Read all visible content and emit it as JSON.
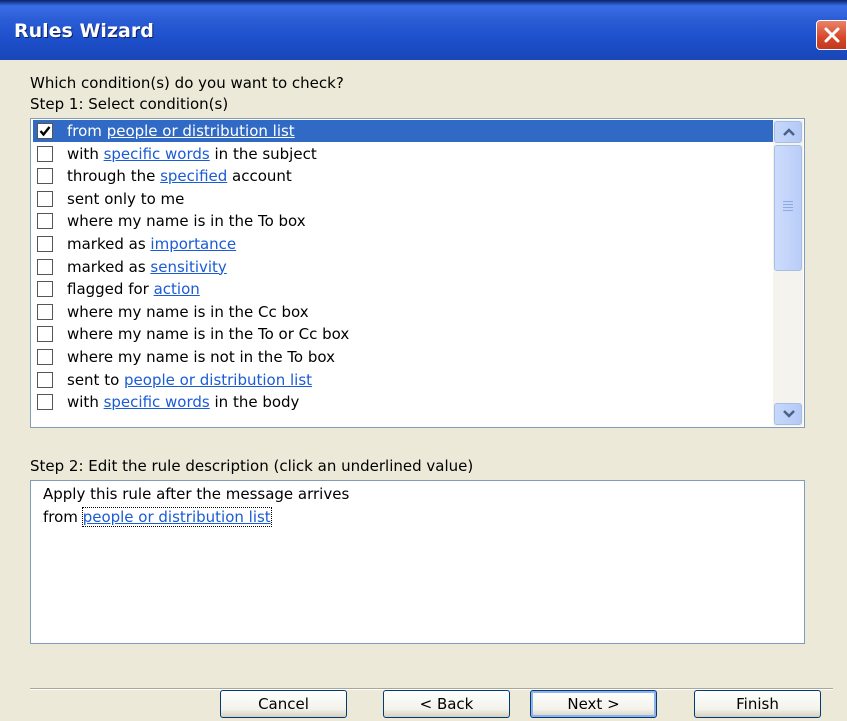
{
  "window": {
    "title": "Rules Wizard"
  },
  "step1": {
    "question": "Which condition(s) do you want to check?",
    "label": "Step 1: Select condition(s)"
  },
  "conditions": [
    {
      "pre": "from ",
      "link": "people or distribution list",
      "post": "",
      "checked": true,
      "selected": true
    },
    {
      "pre": "with ",
      "link": "specific words",
      "post": " in the subject",
      "checked": false,
      "selected": false
    },
    {
      "pre": "through the ",
      "link": "specified",
      "post": " account",
      "checked": false,
      "selected": false
    },
    {
      "pre": "sent only to me",
      "link": "",
      "post": "",
      "checked": false,
      "selected": false
    },
    {
      "pre": "where my name is in the To box",
      "link": "",
      "post": "",
      "checked": false,
      "selected": false
    },
    {
      "pre": "marked as ",
      "link": "importance",
      "post": "",
      "checked": false,
      "selected": false
    },
    {
      "pre": "marked as ",
      "link": "sensitivity",
      "post": "",
      "checked": false,
      "selected": false
    },
    {
      "pre": "flagged for ",
      "link": "action",
      "post": "",
      "checked": false,
      "selected": false
    },
    {
      "pre": "where my name is in the Cc box",
      "link": "",
      "post": "",
      "checked": false,
      "selected": false
    },
    {
      "pre": "where my name is in the To or Cc box",
      "link": "",
      "post": "",
      "checked": false,
      "selected": false
    },
    {
      "pre": "where my name is not in the To box",
      "link": "",
      "post": "",
      "checked": false,
      "selected": false
    },
    {
      "pre": "sent to ",
      "link": "people or distribution list",
      "post": "",
      "checked": false,
      "selected": false
    },
    {
      "pre": "with ",
      "link": "specific words",
      "post": " in the body",
      "checked": false,
      "selected": false
    }
  ],
  "step2": {
    "label": "Step 2: Edit the rule description (click an underlined value)",
    "line1": "Apply this rule after the message arrives",
    "line2_pre": "from ",
    "line2_link": "people or distribution list"
  },
  "buttons": {
    "cancel": "Cancel",
    "back": "< Back",
    "next": "Next >",
    "finish": "Finish"
  },
  "icons": {
    "close": "close-icon",
    "check": "checkmark-icon",
    "scroll_up": "chevron-up-icon",
    "scroll_down": "chevron-down-icon"
  },
  "colors": {
    "titlebar": "#2a5cd6",
    "selection": "#316ac5",
    "link": "#1a5bd6",
    "close": "#d8462a"
  }
}
